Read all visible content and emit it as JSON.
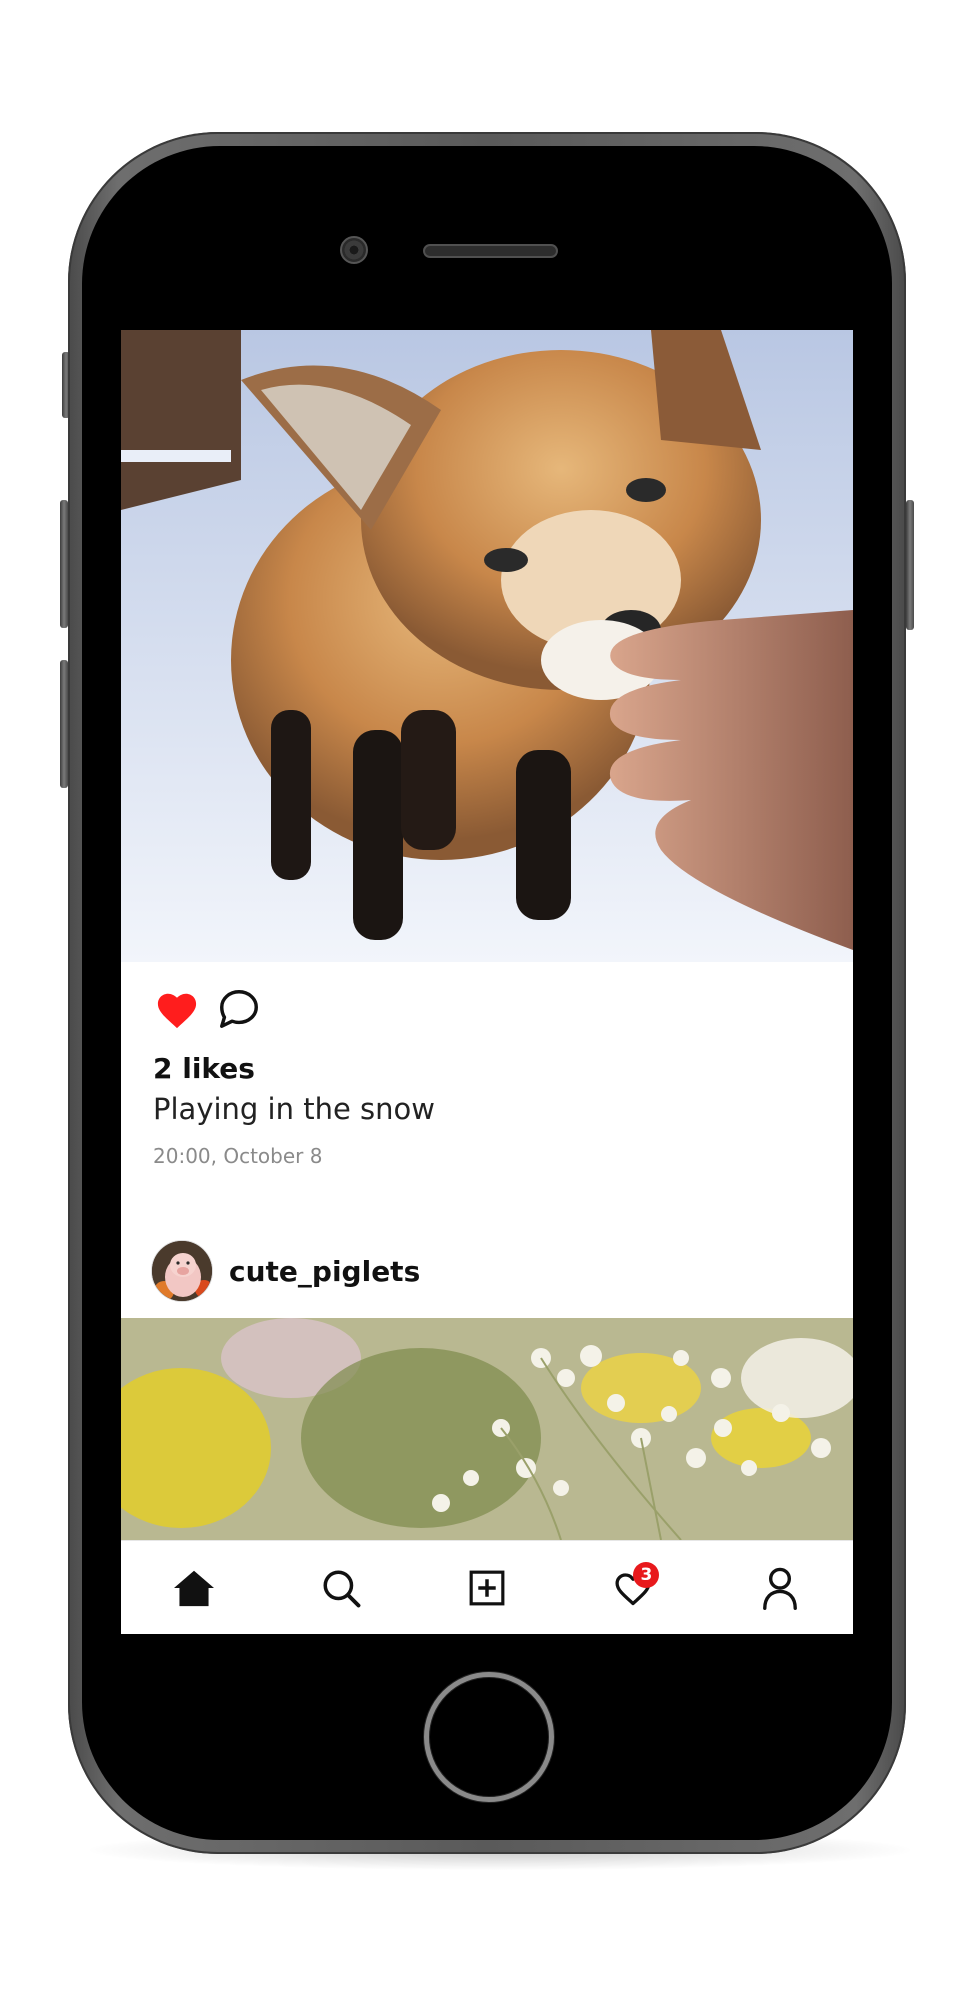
{
  "post": {
    "likes": "2 likes",
    "caption": "Playing in the snow",
    "timestamp": "20:00, October 8",
    "liked": true
  },
  "next_post": {
    "username": "cute_piglets"
  },
  "tabbar": {
    "items": [
      "home-icon",
      "search-icon",
      "add-post-icon",
      "activity-heart-icon",
      "profile-icon"
    ],
    "notifications_badge": "3"
  },
  "colors": {
    "like_red": "#ff1d1d",
    "badge_red": "#e8191c",
    "text_primary": "#111111",
    "text_secondary": "#8a8a8a"
  }
}
